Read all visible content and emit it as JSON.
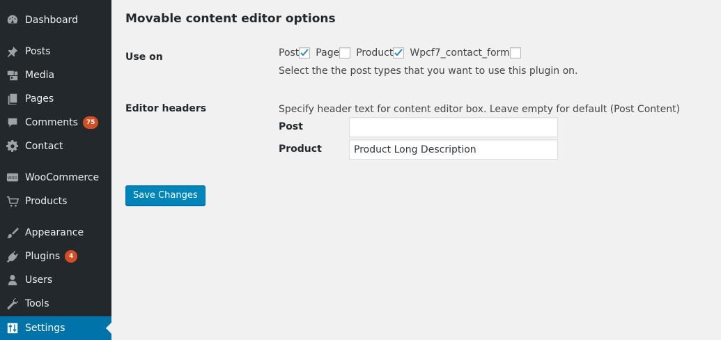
{
  "sidebar": {
    "items": [
      {
        "label": "Dashboard",
        "icon": "dashboard-icon"
      },
      {
        "label": "Posts",
        "icon": "pin-icon"
      },
      {
        "label": "Media",
        "icon": "media-icon"
      },
      {
        "label": "Pages",
        "icon": "pages-icon"
      },
      {
        "label": "Comments",
        "icon": "comment-icon",
        "badge": "75"
      },
      {
        "label": "Contact",
        "icon": "gear-icon"
      },
      {
        "label": "WooCommerce",
        "icon": "woo-icon"
      },
      {
        "label": "Products",
        "icon": "cart-icon"
      },
      {
        "label": "Appearance",
        "icon": "brush-icon"
      },
      {
        "label": "Plugins",
        "icon": "plug-icon",
        "badge": "4"
      },
      {
        "label": "Users",
        "icon": "user-icon"
      },
      {
        "label": "Tools",
        "icon": "wrench-icon"
      },
      {
        "label": "Settings",
        "icon": "settings-icon",
        "current": true
      }
    ]
  },
  "page": {
    "title": "Movable content editor options",
    "use_on": {
      "label": "Use on",
      "options": [
        {
          "label": "Post",
          "checked": true
        },
        {
          "label": "Page",
          "checked": false
        },
        {
          "label": "Product",
          "checked": true
        },
        {
          "label": "Wpcf7_contact_form",
          "checked": false
        }
      ],
      "description": "Select the the post types that you want to use this plugin on."
    },
    "editor_headers": {
      "label": "Editor headers",
      "description": "Specify header text for content editor box. Leave empty for default (Post Content)",
      "fields": [
        {
          "label": "Post",
          "value": ""
        },
        {
          "label": "Product",
          "value": "Product Long Description"
        }
      ]
    },
    "save_label": "Save Changes"
  },
  "colors": {
    "sidebar_bg": "#23282d",
    "accent": "#0073aa",
    "badge": "#d54e21",
    "button": "#0085ba"
  }
}
